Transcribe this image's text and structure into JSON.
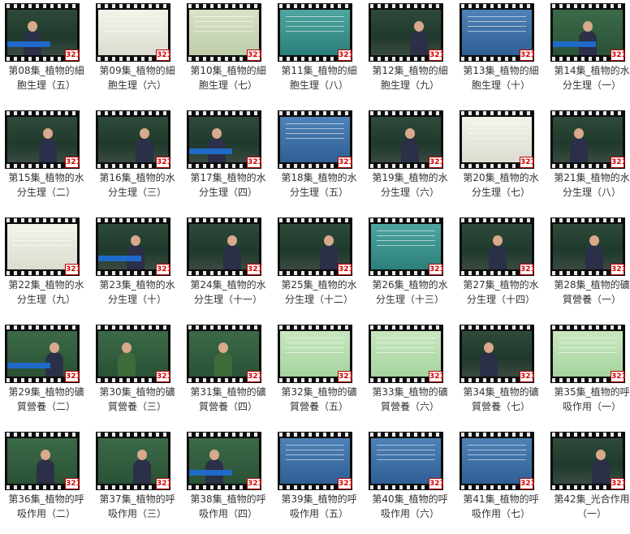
{
  "logo_text": "321",
  "videos": [
    {
      "line1": "第08集_植物的細",
      "line2": "胞生理（五）",
      "style": "board",
      "person": "dark"
    },
    {
      "line1": "第09集_植物的細",
      "line2": "胞生理（六）",
      "style": "white",
      "person": ""
    },
    {
      "line1": "第10集_植物的細",
      "line2": "胞生理（七）",
      "style": "paper",
      "person": ""
    },
    {
      "line1": "第11集_植物的細",
      "line2": "胞生理（八）",
      "style": "teal",
      "person": ""
    },
    {
      "line1": "第12集_植物的細",
      "line2": "胞生理（九）",
      "style": "board",
      "person": "dark"
    },
    {
      "line1": "第13集_植物的細",
      "line2": "胞生理（十）",
      "style": "slide",
      "person": ""
    },
    {
      "line1": "第14集_植物的水",
      "line2": "分生理（一）",
      "style": "greenboard",
      "person": "dark"
    },
    {
      "line1": "第15集_植物的水",
      "line2": "分生理（二）",
      "style": "board",
      "person": "dark"
    },
    {
      "line1": "第16集_植物的水",
      "line2": "分生理（三）",
      "style": "board",
      "person": "dark"
    },
    {
      "line1": "第17集_植物的水",
      "line2": "分生理（四）",
      "style": "board",
      "person": "dark"
    },
    {
      "line1": "第18集_植物的水",
      "line2": "分生理（五）",
      "style": "slide",
      "person": ""
    },
    {
      "line1": "第19集_植物的水",
      "line2": "分生理（六）",
      "style": "board",
      "person": "dark"
    },
    {
      "line1": "第20集_植物的水",
      "line2": "分生理（七）",
      "style": "white",
      "person": ""
    },
    {
      "line1": "第21集_植物的水",
      "line2": "分生理（八）",
      "style": "board",
      "person": "dark"
    },
    {
      "line1": "第22集_植物的水",
      "line2": "分生理（九）",
      "style": "white",
      "person": ""
    },
    {
      "line1": "第23集_植物的水",
      "line2": "分生理（十）",
      "style": "board",
      "person": "dark"
    },
    {
      "line1": "第24集_植物的水",
      "line2": "分生理（十一）",
      "style": "board",
      "person": "dark"
    },
    {
      "line1": "第25集_植物的水",
      "line2": "分生理（十二）",
      "style": "board",
      "person": "dark"
    },
    {
      "line1": "第26集_植物的水",
      "line2": "分生理（十三）",
      "style": "teal",
      "person": ""
    },
    {
      "line1": "第27集_植物的水",
      "line2": "分生理（十四）",
      "style": "board",
      "person": "dark"
    },
    {
      "line1": "第28集_植物的礦",
      "line2": "質營養（一）",
      "style": "board",
      "person": "dark"
    },
    {
      "line1": "第29集_植物的礦",
      "line2": "質營養（二）",
      "style": "greenboard",
      "person": "dark"
    },
    {
      "line1": "第30集_植物的礦",
      "line2": "質營養（三）",
      "style": "greenboard",
      "person": "green"
    },
    {
      "line1": "第31集_植物的礦",
      "line2": "質營養（四）",
      "style": "greenboard",
      "person": "green"
    },
    {
      "line1": "第32集_植物的礦",
      "line2": "質營養（五）",
      "style": "lightgreen",
      "person": ""
    },
    {
      "line1": "第33集_植物的礦",
      "line2": "質營養（六）",
      "style": "lightgreen",
      "person": ""
    },
    {
      "line1": "第34集_植物的礦",
      "line2": "質營養（七）",
      "style": "board",
      "person": "dark"
    },
    {
      "line1": "第35集_植物的呼",
      "line2": "吸作用（一）",
      "style": "lightgreen",
      "person": ""
    },
    {
      "line1": "第36集_植物的呼",
      "line2": "吸作用（二）",
      "style": "greenboard",
      "person": "dark"
    },
    {
      "line1": "第37集_植物的呼",
      "line2": "吸作用（三）",
      "style": "greenboard",
      "person": "dark"
    },
    {
      "line1": "第38集_植物的呼",
      "line2": "吸作用（四）",
      "style": "greenboard",
      "person": "dark"
    },
    {
      "line1": "第39集_植物的呼",
      "line2": "吸作用（五）",
      "style": "slide",
      "person": ""
    },
    {
      "line1": "第40集_植物的呼",
      "line2": "吸作用（六）",
      "style": "slide",
      "person": ""
    },
    {
      "line1": "第41集_植物的呼",
      "line2": "吸作用（七）",
      "style": "slide",
      "person": ""
    },
    {
      "line1": "第42集_光合作用",
      "line2": "（一）",
      "style": "board",
      "person": "dark"
    }
  ]
}
